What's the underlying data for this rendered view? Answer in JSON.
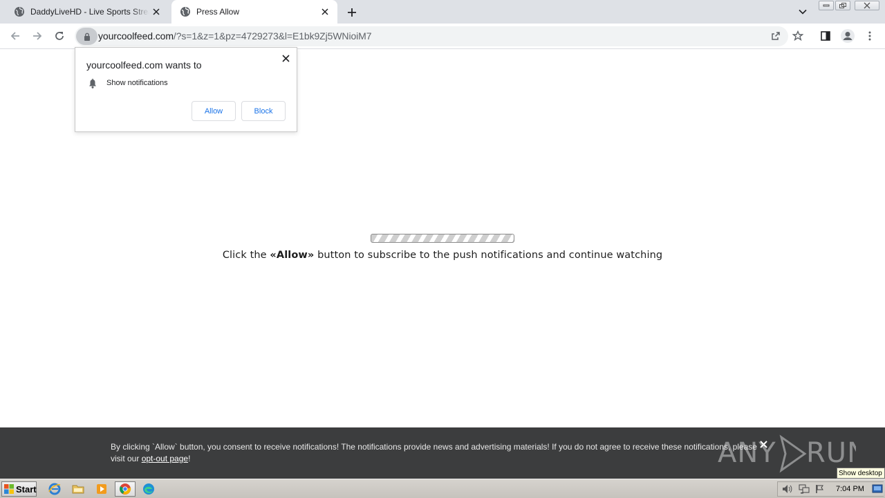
{
  "tabs": [
    {
      "title": "DaddyLiveHD - Live Sports Streaming",
      "active": false
    },
    {
      "title": "Press Allow",
      "active": true
    }
  ],
  "omnibox": {
    "domain": "yourcoolfeed.com",
    "path": "/?s=1&z=1&pz=4729273&l=E1bk9Zj5WNioiM7"
  },
  "permission_prompt": {
    "title": "yourcoolfeed.com wants to",
    "message": "Show notifications",
    "allow_label": "Allow",
    "block_label": "Block"
  },
  "page": {
    "instruction_before": "Click the ",
    "instruction_bold": "«Allow»",
    "instruction_after": " button to subscribe to the push notifications and continue watching"
  },
  "consent_bar": {
    "text": "By clicking `Allow` button, you consent to receive notifications! The notifications provide news and advertising materials! If you do not agree to receive these notifications, please visit our ",
    "link_label": "opt-out page",
    "text_end": "!"
  },
  "watermark": "ANY RUN",
  "taskbar": {
    "start_label": "Start",
    "clock": "7:04 PM",
    "tooltip": "Show desktop"
  },
  "icons": [
    "globe-icon",
    "close-icon",
    "plus-icon",
    "chevron-down-icon",
    "back-arrow-icon",
    "forward-arrow-icon",
    "reload-icon",
    "lock-icon",
    "share-icon",
    "star-icon",
    "side-panel-icon",
    "profile-icon",
    "kebab-menu-icon",
    "bell-icon"
  ],
  "colors": {
    "tabstrip_bg": "#dee1e6",
    "link_blue": "#1a73e8",
    "consent_bg": "#3c3d3e"
  }
}
